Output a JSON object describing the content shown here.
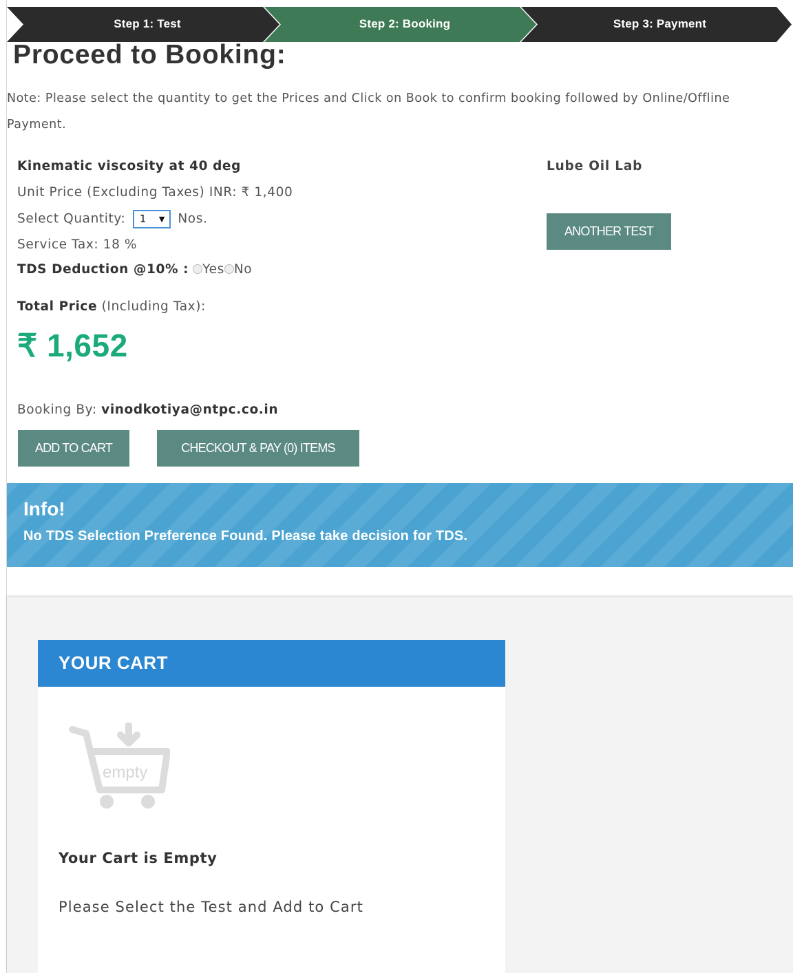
{
  "steps": [
    {
      "label": "Step 1: Test",
      "state": "done"
    },
    {
      "label": "Step 2: Booking",
      "state": "active"
    },
    {
      "label": "Step 3: Payment",
      "state": "pending"
    }
  ],
  "colors": {
    "step_dark": "#2b2b2b",
    "step_active": "#3e7a55",
    "price_green": "#1aaa7c",
    "button": "#5b8a82",
    "info_bg": "#4aa3d1",
    "cart_header": "#2b87d1"
  },
  "page": {
    "title": "Proceed to Booking:",
    "note": "Note: Please select the quantity to get the Prices and Click on Book to confirm booking followed by Online/Offline Payment."
  },
  "booking": {
    "test_name": "Kinematic viscosity at 40 deg",
    "unit_price_label": "Unit Price (Excluding Taxes) INR:",
    "unit_price_value": "₹ 1,400",
    "quantity_label": "Select Quantity:",
    "quantity_value": "1",
    "quantity_unit": "Nos.",
    "service_tax_label": "Service Tax:",
    "service_tax_value": "18 %",
    "tds_label": "TDS Deduction @10% :",
    "tds_yes": "Yes",
    "tds_no": "No",
    "total_label_bold": "Total Price",
    "total_label_rest": "(Including Tax):",
    "total_value": "₹ 1,652",
    "booking_by_label": "Booking By:",
    "booking_by_value": "vinodkotiya@ntpc.co.in",
    "lab_name": "Lube Oil Lab",
    "another_test_label": "ANOTHER TEST",
    "add_to_cart_label": "ADD TO CART",
    "checkout_label": "CHECKOUT & PAY (0) ITEMS"
  },
  "info": {
    "title": "Info!",
    "message": "No TDS Selection Preference Found. Please take decision for TDS."
  },
  "cart": {
    "header": "YOUR CART",
    "icon": "empty-cart-icon",
    "icon_text": "empty",
    "empty_title": "Your Cart is Empty",
    "empty_message": "Please Select the Test and Add to Cart"
  }
}
